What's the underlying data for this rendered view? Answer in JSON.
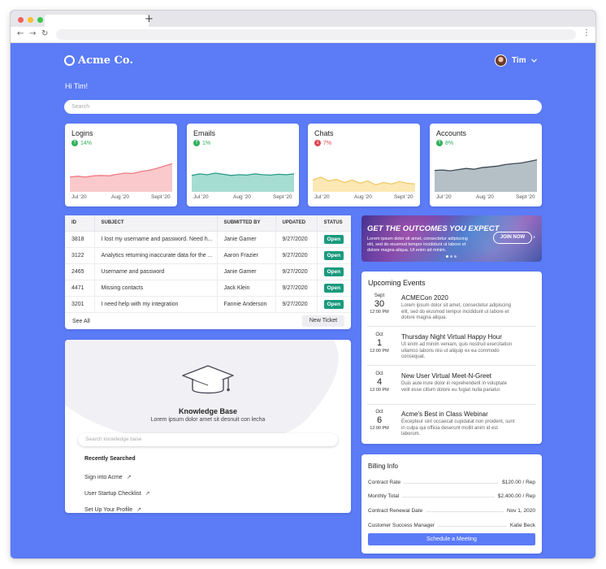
{
  "browser": {
    "new_tab_icon": "plus-icon",
    "menu_icon": "kebab-icon"
  },
  "header": {
    "brand": "Acme Co.",
    "user_name": "Tim"
  },
  "greeting": "Hi Tim!",
  "search": {
    "placeholder": "Search"
  },
  "stats": [
    {
      "title": "Logins",
      "delta": "14%",
      "trend": "up",
      "fill": "#f9c9cc",
      "stroke": "#f27a85",
      "x_labels": [
        "Jul '20",
        "Aug '20",
        "Sept '20"
      ],
      "series": [
        0.38,
        0.4,
        0.38,
        0.41,
        0.42,
        0.41,
        0.45,
        0.48,
        0.47,
        0.52,
        0.55,
        0.6,
        0.66,
        0.72
      ]
    },
    {
      "title": "Emails",
      "delta": "1%",
      "trend": "up",
      "fill": "#a6ddd3",
      "stroke": "#2a9c86",
      "x_labels": [
        "Jul '20",
        "Aug '20",
        "Sept '20"
      ],
      "series": [
        0.42,
        0.46,
        0.44,
        0.48,
        0.45,
        0.42,
        0.44,
        0.43,
        0.46,
        0.44,
        0.43,
        0.45,
        0.44,
        0.46
      ]
    },
    {
      "title": "Chats",
      "delta": "7%",
      "trend": "down",
      "fill": "#fbe8b4",
      "stroke": "#f1c96a",
      "x_labels": [
        "Jul '20",
        "Aug '20",
        "Sept '20"
      ],
      "series": [
        0.3,
        0.38,
        0.28,
        0.32,
        0.24,
        0.3,
        0.22,
        0.28,
        0.18,
        0.24,
        0.2,
        0.26,
        0.22,
        0.2
      ]
    },
    {
      "title": "Accounts",
      "delta": "8%",
      "trend": "up",
      "fill": "#b4bfc6",
      "stroke": "#3c4a55",
      "x_labels": [
        "Jul '20",
        "Aug '20",
        "Sept '20"
      ],
      "series": [
        0.55,
        0.56,
        0.54,
        0.57,
        0.6,
        0.58,
        0.62,
        0.64,
        0.66,
        0.7,
        0.72,
        0.74,
        0.78,
        0.82
      ]
    }
  ],
  "tickets": {
    "columns": [
      "ID",
      "SUBJECT",
      "SUBMITTED BY",
      "UPDATED",
      "STATUS"
    ],
    "rows": [
      {
        "id": "3818",
        "subject": "I lost my username and password. Need h...",
        "by": "Janie Gamer",
        "updated": "9/27/2020",
        "status": "Open"
      },
      {
        "id": "3122",
        "subject": "Analytics returning inaccurate data for the ...",
        "by": "Aaron Frazier",
        "updated": "9/27/2020",
        "status": "Open"
      },
      {
        "id": "2465",
        "subject": "Username and password",
        "by": "Janie Gamer",
        "updated": "9/27/2020",
        "status": "Open"
      },
      {
        "id": "4471",
        "subject": "Missing contacts",
        "by": "Jack Klein",
        "updated": "9/27/2020",
        "status": "Open"
      },
      {
        "id": "3201",
        "subject": "I need help with my integration",
        "by": "Fannie Anderson",
        "updated": "9/27/2020",
        "status": "Open"
      }
    ],
    "see_all": "See All",
    "new_ticket": "New Ticket"
  },
  "banner": {
    "headline": "GET THE OUTCOMES YOU EXPECT",
    "body": "Lorem ipsum dolor sit amet, consectetur adipiscing elit, sed do eiusmod tempor incididunt ut labore et dolore magna aliqua. Ut enim ad minim.",
    "cta": "JOIN NOW"
  },
  "events": {
    "title": "Upcoming Events",
    "items": [
      {
        "month": "Sept",
        "day": "30",
        "time": "12:00 PM",
        "name": "ACMECon 2020",
        "desc": "Lorem ipsum dolor sit amet, consectetur adipiscing elit, sed do eiusmod tempor incididunt ut labore et dolore magna aliqua."
      },
      {
        "month": "Oct",
        "day": "1",
        "time": "12:00 PM",
        "name": "Thursday Night Virtual Happy Hour",
        "desc": "Ut enim ad minim veniam, quis nostrud exercitation ullamco laboris nisi ut aliquip ex ea commodo consequat."
      },
      {
        "month": "Oct",
        "day": "4",
        "time": "12:00 PM",
        "name": "New User Virtual Meet-N-Greet",
        "desc": "Duis aute irure dolor in reprehenderit in voluptate velit esse cillum dolore eu fugiat nulla pariatur."
      },
      {
        "month": "Oct",
        "day": "6",
        "time": "12:00 PM",
        "name": "Acme's Best in Class Webinar",
        "desc": "Excepteur sint occaecat cupidatat non proident, sunt in culpa qui officia deserunt mollit anim id est laborum."
      }
    ]
  },
  "knowledge": {
    "title": "Knowledge Base",
    "subtitle": "Lorem ipsum dolor amet sit desnuit con lecha",
    "search_placeholder": "Search knowledge base",
    "recent_title": "Recently Searched",
    "links": [
      "Sign into Acme",
      "User Startup Checklist",
      "Set Up Your Profile"
    ]
  },
  "billing": {
    "title": "Billing Info",
    "rows": [
      {
        "label": "Contract Rate",
        "value": "$120.00 / Rep"
      },
      {
        "label": "Monthly Total",
        "value": "$2,400.00 / Rep"
      },
      {
        "label": "Contract Renewal Date",
        "value": "Nov 1, 2020"
      },
      {
        "label": "Customer Success Manager",
        "value": "Katie Beck"
      }
    ],
    "cta": "Schedule a Meeting"
  },
  "colors": {
    "page_bg": "#5b7bf7",
    "accent": "#5b7bf7",
    "status_open": "#1a9a7d",
    "delta_up": "#2fb05a",
    "delta_down": "#e0454f"
  }
}
